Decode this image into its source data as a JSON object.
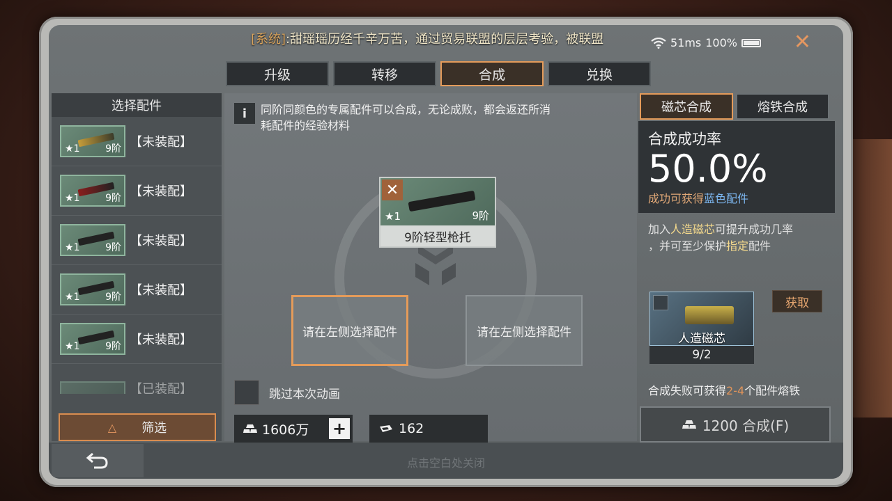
{
  "system_message": {
    "tag": "[系统]",
    "text": ":甜瑶瑶历经千辛万苦，通过贸易联盟的层层考验，被联盟"
  },
  "status": {
    "ping": "51ms",
    "battery": "100%"
  },
  "tabs": [
    {
      "label": "升级",
      "active": false
    },
    {
      "label": "转移",
      "active": false
    },
    {
      "label": "合成",
      "active": true
    },
    {
      "label": "兑换",
      "active": false
    }
  ],
  "left_panel": {
    "title": "选择配件",
    "items": [
      {
        "stars": "1",
        "tier": "9阶",
        "status": "【未装配】",
        "style": "gold"
      },
      {
        "stars": "1",
        "tier": "9阶",
        "status": "【未装配】",
        "style": "red"
      },
      {
        "stars": "1",
        "tier": "9阶",
        "status": "【未装配】",
        "style": "dark"
      },
      {
        "stars": "1",
        "tier": "9阶",
        "status": "【未装配】",
        "style": "dark"
      },
      {
        "stars": "1",
        "tier": "9阶",
        "status": "【未装配】",
        "style": "dark"
      },
      {
        "stars": "",
        "tier": "",
        "status": "【已装配】",
        "style": "dark"
      }
    ],
    "filter_label": "筛选"
  },
  "center": {
    "info_icon": "i",
    "info_text": "同阶同颜色的专属配件可以合成，无论成败，都会返还所消耗配件的经验材料",
    "result": {
      "stars": "1",
      "tier": "9阶",
      "name": "9阶轻型枪托"
    },
    "slot_left": "请在左侧选择配件",
    "slot_right": "请在左侧选择配件",
    "skip_label": "跳过本次动画",
    "currency1": "1606万",
    "currency2": "162"
  },
  "right_panel": {
    "tab1": "磁芯合成",
    "tab2": "熔铁合成",
    "rate_title": "合成成功率",
    "rate_value": "50.0%",
    "rate_sub_prefix": "成功可获得",
    "rate_sub_blue": "蓝色配件",
    "boost_line1_a": "加入",
    "boost_line1_hl": "人造磁芯",
    "boost_line1_b": "可提升成功几率",
    "boost_line2_a": "，并可至少保护",
    "boost_line2_hl": "指定",
    "boost_line2_b": "配件",
    "core_name": "人造磁芯",
    "core_count": "9/2",
    "get_label": "获取",
    "fail_prefix": "合成失败可获得",
    "fail_range": "2-4",
    "fail_suffix": "个配件熔铁",
    "compose_label": "1200 合成(F)"
  },
  "bottom": {
    "hint": "点击空白处关闭"
  },
  "colors": {
    "accent": "#e49b5a",
    "blue_text": "#7cb6ef",
    "highlight": "#f4d98c"
  }
}
